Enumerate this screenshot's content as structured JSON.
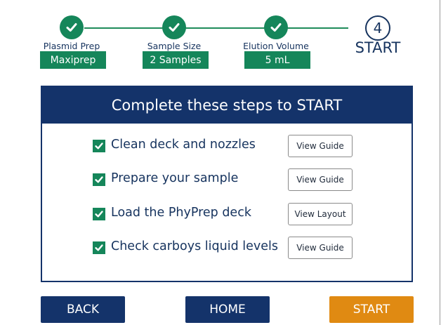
{
  "colors": {
    "navy": "#14336a",
    "green": "#15865a",
    "orange": "#e08a12"
  },
  "stepper": {
    "steps": [
      {
        "label": "Plasmid Prep",
        "value": "Maxiprep",
        "status": "complete",
        "icon": "check-icon"
      },
      {
        "label": "Sample Size",
        "value": "2 Samples",
        "status": "complete",
        "icon": "check-icon"
      },
      {
        "label": "Elution Volume",
        "value": "5 mL",
        "status": "complete",
        "icon": "check-icon"
      },
      {
        "number": "4",
        "label": "START",
        "status": "current"
      }
    ]
  },
  "panel": {
    "title": "Complete these steps to START",
    "items": [
      {
        "label": "Clean deck and nozzles",
        "checked": true,
        "button": "View Guide"
      },
      {
        "label": "Prepare your sample",
        "checked": true,
        "button": "View Guide"
      },
      {
        "label": "Load the PhyPrep deck",
        "checked": true,
        "button": "View Layout"
      },
      {
        "label": "Check carboys liquid levels",
        "checked": true,
        "button": "View Guide"
      }
    ]
  },
  "nav": {
    "back": "BACK",
    "home": "HOME",
    "start": "START"
  }
}
